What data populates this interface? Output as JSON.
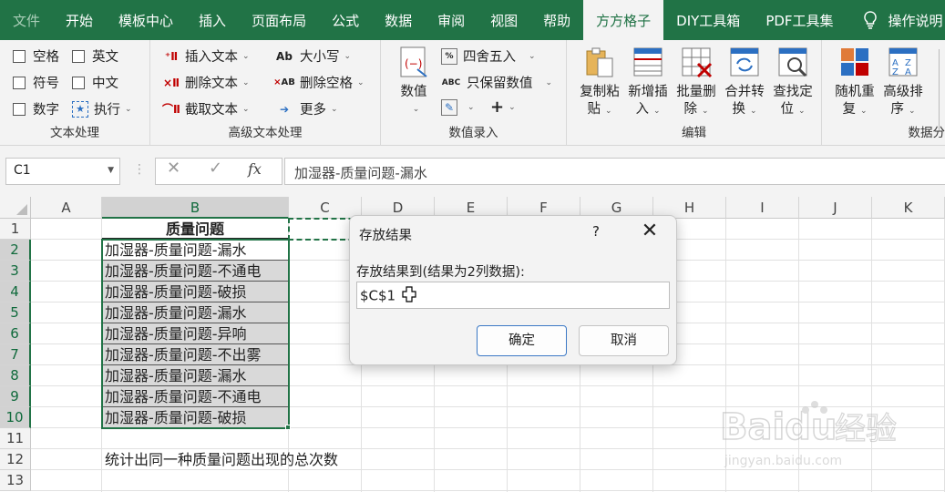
{
  "menu": {
    "tabs": [
      "文件",
      "开始",
      "模板中心",
      "插入",
      "页面布局",
      "公式",
      "数据",
      "审阅",
      "视图",
      "帮助",
      "方方格子",
      "DIY工具箱",
      "PDF工具集"
    ],
    "active": "方方格子",
    "help_label": "操作说明"
  },
  "ribbon": {
    "text_processing": {
      "title": "文本处理",
      "checks": [
        "空格",
        "英文",
        "符号",
        "中文",
        "数字"
      ],
      "execute": "执行"
    },
    "advanced_text": {
      "title": "高级文本处理",
      "insert_text": "插入文本",
      "delete_text": "删除文本",
      "extract_text": "截取文本",
      "case": "大小写",
      "delete_spaces": "删除空格",
      "more": "更多"
    },
    "data_entry": {
      "title": "数值录入",
      "number": "数值",
      "round": "四舍五入",
      "keep_values": "只保留数值",
      "plus": "+"
    },
    "edit": {
      "title": "编辑",
      "buttons": [
        {
          "line1": "复制粘",
          "line2": "贴"
        },
        {
          "line1": "新增插",
          "line2": "入"
        },
        {
          "line1": "批量删",
          "line2": "除"
        },
        {
          "line1": "合并转",
          "line2": "换"
        },
        {
          "line1": "查找定",
          "line2": "位"
        }
      ]
    },
    "data_analysis": {
      "title": "数据分",
      "buttons": [
        {
          "line1": "随机重",
          "line2": "复"
        },
        {
          "line1": "高级排",
          "line2": "序"
        }
      ]
    }
  },
  "formula_bar": {
    "name_box": "C1",
    "cancel": "✕",
    "enter": "✓",
    "fx": "fx",
    "content": "加湿器-质量问题-漏水"
  },
  "sheet": {
    "columns": [
      "A",
      "B",
      "C",
      "D",
      "E",
      "F",
      "G",
      "H",
      "I",
      "J",
      "K"
    ],
    "rows": [
      "1",
      "2",
      "3",
      "4",
      "5",
      "6",
      "7",
      "8",
      "9",
      "10",
      "11",
      "12",
      "13"
    ],
    "b1": "质量问题",
    "b_values": [
      "加湿器-质量问题-漏水",
      "加湿器-质量问题-不通电",
      "加湿器-质量问题-破损",
      "加湿器-质量问题-漏水",
      "加湿器-质量问题-异响",
      "加湿器-质量问题-不出雾",
      "加湿器-质量问题-漏水",
      "加湿器-质量问题-不通电",
      "加湿器-质量问题-破损"
    ],
    "b12": "统计出同一种质量问题出现的总次数"
  },
  "dialog": {
    "title": "存放结果",
    "help": "?",
    "close": "✕",
    "label": "存放结果到(结果为2列数据):",
    "input_value": "$C$1",
    "ok": "确定",
    "cancel": "取消"
  },
  "watermark": {
    "brand": "Baidu",
    "suffix": "经验",
    "url": "jingyan.baidu.com"
  }
}
